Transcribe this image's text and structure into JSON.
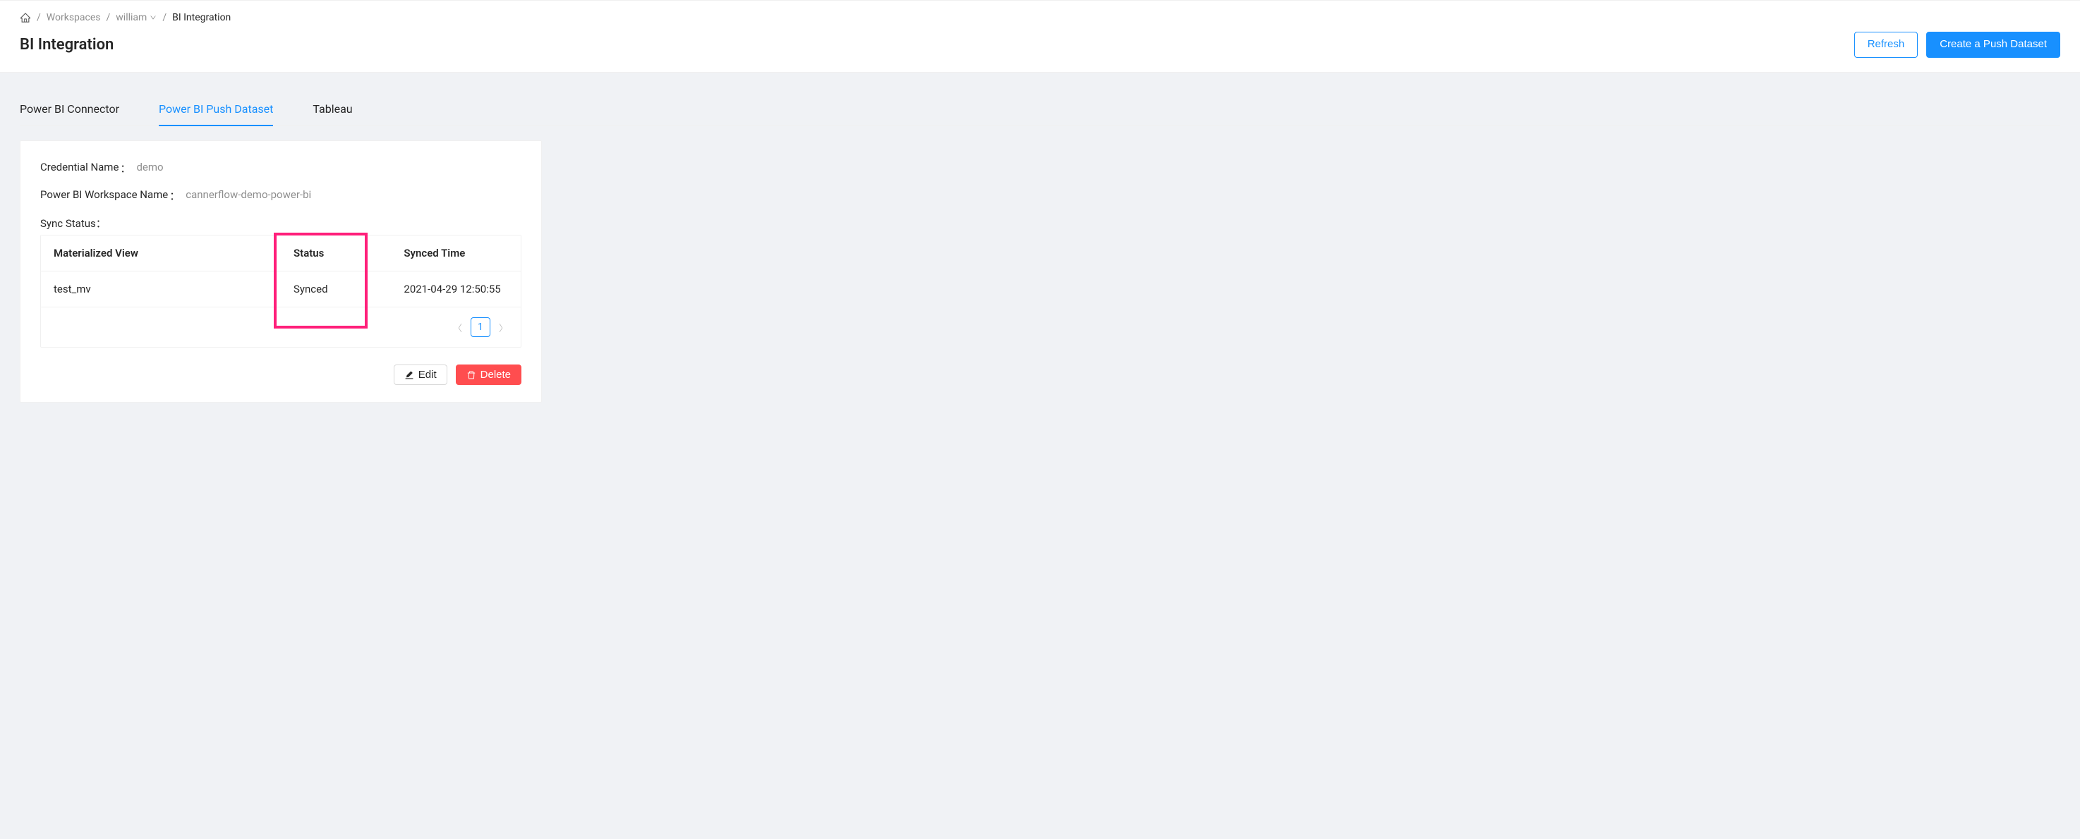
{
  "breadcrumb": {
    "workspaces": "Workspaces",
    "user": "william",
    "current": "BI Integration"
  },
  "page": {
    "title": "BI Integration"
  },
  "header_buttons": {
    "refresh": "Refresh",
    "create_push": "Create a Push Dataset"
  },
  "tabs": {
    "powerbi_connector": "Power BI Connector",
    "powerbi_push": "Power BI Push Dataset",
    "tableau": "Tableau"
  },
  "details": {
    "credential_label": "Credential Name",
    "credential_value": "demo",
    "workspace_label": "Power BI Workspace Name",
    "workspace_value": "cannerflow-demo-power-bi",
    "sync_status_label": "Sync Status"
  },
  "table": {
    "columns": {
      "mv": "Materialized View",
      "status": "Status",
      "synced_time": "Synced Time"
    },
    "rows": [
      {
        "mv": "test_mv",
        "status": "Synced",
        "synced_time": "2021-04-29 12:50:55"
      }
    ]
  },
  "pagination": {
    "page": "1"
  },
  "actions": {
    "edit": "Edit",
    "delete": "Delete"
  }
}
